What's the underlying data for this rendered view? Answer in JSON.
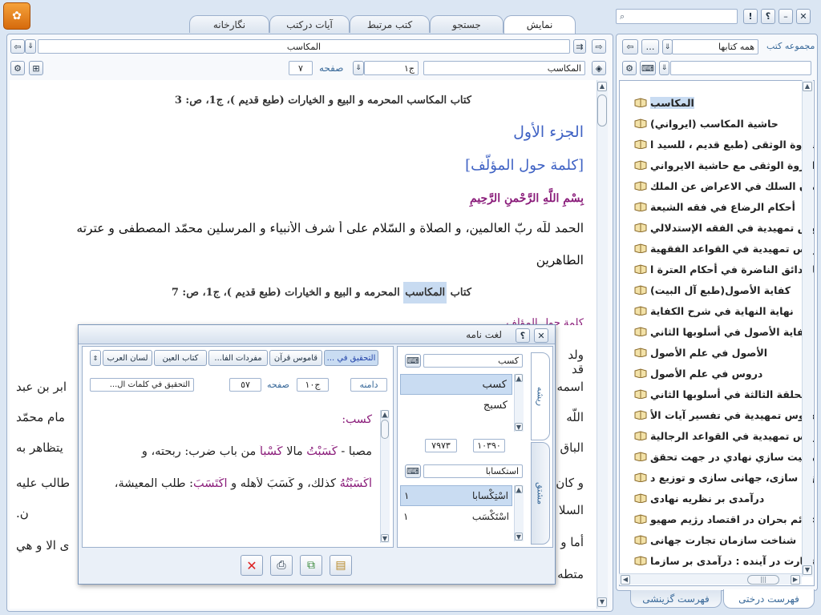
{
  "tabs": [
    {
      "label": "نمایش"
    },
    {
      "label": "جستجو"
    },
    {
      "label": "کتب مرتبط"
    },
    {
      "label": "آیات درکتب"
    },
    {
      "label": "نگارخانه"
    }
  ],
  "window_buttons": {
    "help": "؟",
    "info": "!"
  },
  "search": {
    "placeholder": ""
  },
  "left_panel": {
    "collection_label": "مجموعه کتب",
    "collection_value": "همه کتابها",
    "books": [
      "المكاسب",
      "حاشية المكاسب (ايرواني)",
      "العروة الوثقى (طبع قديم ، للسيد ا",
      "العروة الوثقى مع حاشية الايرواني",
      "جمان السلك في الاعراض عن الملك",
      "أحكام الرضاع في فقه الشيعة",
      "دروس تمهيدية في الفقه الإستدلالي",
      "دروس تمهيدية في القواعد الفقهية",
      "الحدائق الناضرة في أحكام العترة ا",
      "كفاية الأصول(طبع آل البيت)",
      "نهاية النهاية في شرح الكفاية",
      "كفاية الأصول في أسلوبها الثاني",
      "الأصول في علم الأصول",
      "دروس في علم الأصول",
      "الحلقة الثالثة في أسلوبها الثاني",
      "دروس تمهيدية في تفسير آيات الأ",
      "دروس تمهيدية في القواعد الرجالية",
      "ظرفيت سازي نهادي در جهت تحقق",
      "آزاد سازی، جهانی سازی و توزیع د",
      "درآمدی بر نظریه نهادی",
      "علائم بحران در اقتصاد رژیم صهیو",
      "شناخت سازمان تجارت جهانی",
      "تجارت در آینده : درآمدی بر سازما"
    ],
    "bottom_tabs": [
      "فهرست درختی",
      "فهرست گزینشی"
    ]
  },
  "nav": {
    "title": "المكاسب",
    "book_field": "المكاسب",
    "volume": "ج١",
    "page_label": "صفحه",
    "page": "٧"
  },
  "content": {
    "heading1": "كتاب المكاسب المحرمه و البيع و الخيارات (طبع قديم )، ج‏1، ص: 3",
    "part": "الجزء الأول",
    "intro": "[كلمة حول المؤلّف]",
    "basmala": "بِسْمِ اللَّهِ الرَّحْمنِ الرَّحِيمِ",
    "para1": "الحمد للّه ربّ العالمين، و الصلاة و السّلام على أ شرف الأنبياء و المرسلين محمّد المصطفى و عترته",
    "para1b": "الطاهرين",
    "heading2_pre": "كتاب ",
    "heading2_hl": "المكاسب",
    "heading2_post": " المحرمه و البيع و الخيارات (طبع قديم )، ج‏1، ص: 7",
    "intro2": "كلمة حول المؤلّف",
    "frag_r": [
      "ولد قد",
      "اسمه",
      "اللّه",
      "الباق",
      "و كان",
      "السلا",
      "أما و",
      "متطه"
    ],
    "frag_l": [
      "",
      "ابر بن عبد",
      "مام محمّد",
      "يتظاهر به",
      "طالب عليه",
      "ن.",
      "ى الا و هي",
      ""
    ]
  },
  "dialog": {
    "title": "لغت نامه",
    "root_tab": "ریشه",
    "deriv_tab": "مشتق",
    "root_input": "كسب",
    "root_items": [
      "كسب",
      "كسبج"
    ],
    "num_a": "۱۰۳۹۰",
    "num_b": "۷۹۷۳",
    "deriv_input": "استكسابا",
    "deriv_items": [
      {
        "word": "اسْتِكْسابا",
        "count": "۱"
      },
      {
        "word": "اسْتَكْسَب",
        "count": "۱"
      }
    ],
    "dict_tabs": [
      "لسان العرب",
      "كتاب العين",
      "مفردات الفا...",
      "قاموس قرآن",
      "التحقيق في ..."
    ],
    "range_label": "دامنه",
    "vol": "ج١٠",
    "page_label": "صفحه",
    "page": "٥٧",
    "source": "التحقيق في كلمات ال...",
    "entry_head": "كسب:",
    "entry_l1a": "مصبا - ",
    "entry_l1b": "كَسَبْتُ",
    "entry_l1c": " مالا ",
    "entry_l1d": "كَسْباً",
    "entry_l1e": " من باب ضرب: ربحته، و",
    "entry_l2a": "أَكْسَبْتُهُ",
    "entry_l2b": " كذلك، و كَسَبَ لأهله و ",
    "entry_l2c": "اكْتَسَبَ",
    "entry_l2d": ": طلب المعيشة،"
  }
}
